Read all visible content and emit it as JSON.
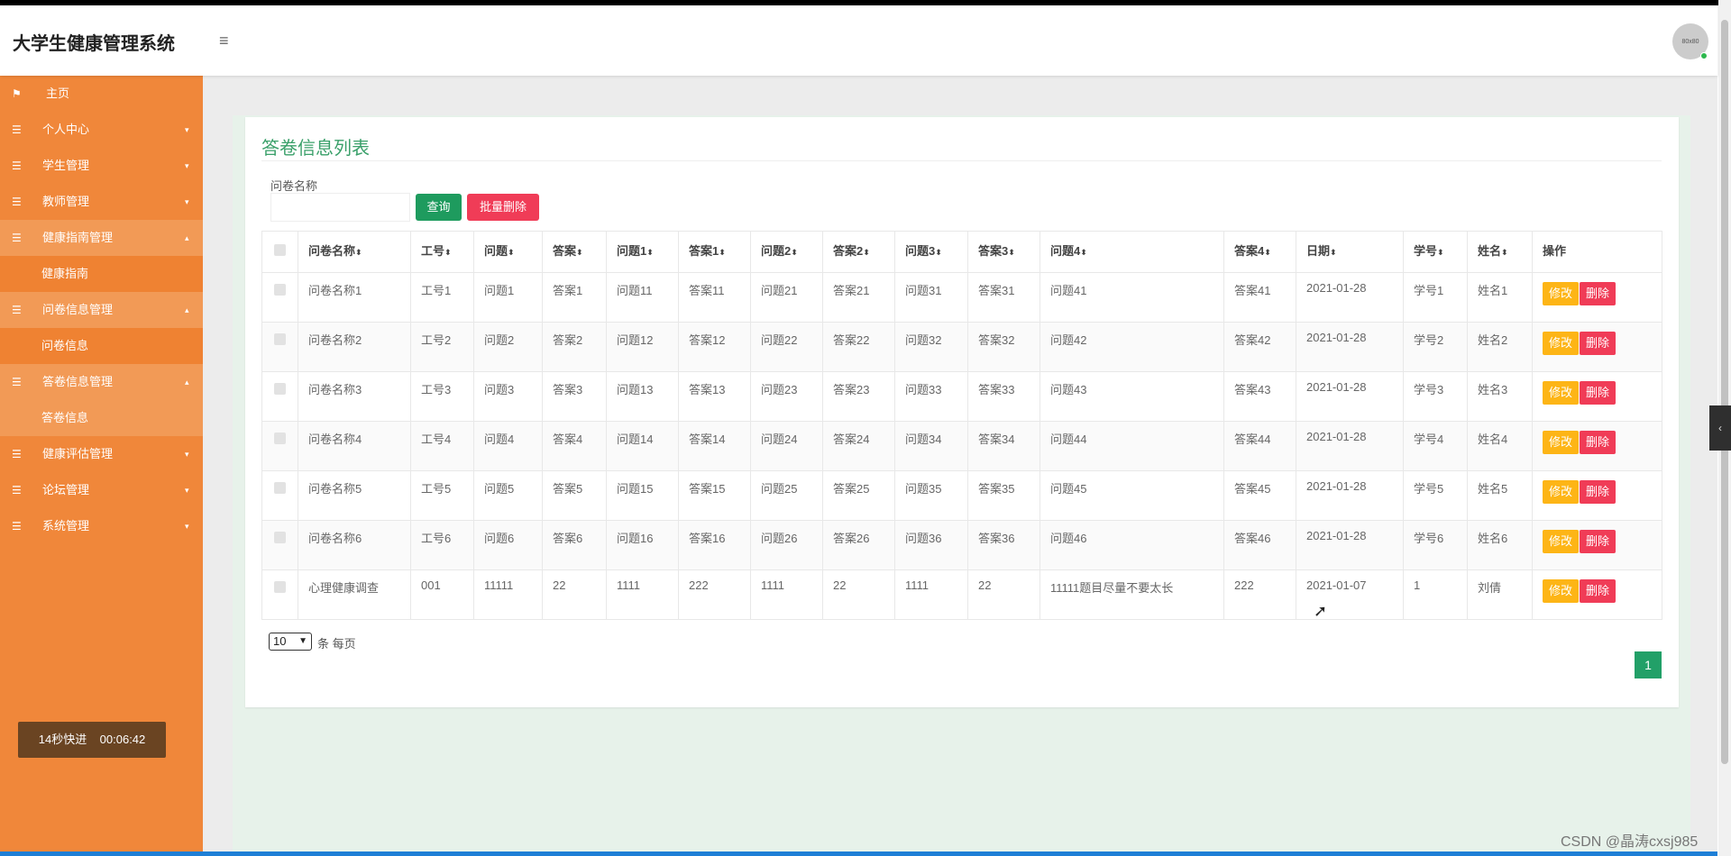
{
  "app": {
    "title": "大学生健康管理系统",
    "avatar_text": "80x80"
  },
  "sidebar": {
    "items": [
      {
        "label": "主页",
        "icon": "flag-icon"
      },
      {
        "label": "个人中心",
        "icon": "list-icon"
      },
      {
        "label": "学生管理",
        "icon": "list-icon"
      },
      {
        "label": "教师管理",
        "icon": "list-icon"
      },
      {
        "label": "健康指南管理",
        "icon": "list-icon"
      },
      {
        "label": "健康指南"
      },
      {
        "label": "问卷信息管理",
        "icon": "list-icon"
      },
      {
        "label": "问卷信息"
      },
      {
        "label": "答卷信息管理",
        "icon": "list-icon"
      },
      {
        "label": "答卷信息"
      },
      {
        "label": "健康评估管理",
        "icon": "list-icon"
      },
      {
        "label": "论坛管理",
        "icon": "list-icon"
      },
      {
        "label": "系统管理",
        "icon": "list-icon"
      }
    ],
    "timer_label": "14秒快进",
    "timer_value": "00:06:42"
  },
  "main": {
    "card_title": "答卷信息列表",
    "search_label": "问卷名称",
    "search_value": "",
    "query_button": "查询",
    "batch_delete_button": "批量删除",
    "table": {
      "headers": [
        "问卷名称",
        "工号",
        "问题",
        "答案",
        "问题1",
        "答案1",
        "问题2",
        "答案2",
        "问题3",
        "答案3",
        "问题4",
        "答案4",
        "日期",
        "学号",
        "姓名",
        "操作"
      ],
      "rows": [
        [
          "问卷名称1",
          "工号1",
          "问题1",
          "答案1",
          "问题11",
          "答案11",
          "问题21",
          "答案21",
          "问题31",
          "答案31",
          "问题41",
          "答案41",
          "2021-01-28",
          "学号1",
          "姓名1"
        ],
        [
          "问卷名称2",
          "工号2",
          "问题2",
          "答案2",
          "问题12",
          "答案12",
          "问题22",
          "答案22",
          "问题32",
          "答案32",
          "问题42",
          "答案42",
          "2021-01-28",
          "学号2",
          "姓名2"
        ],
        [
          "问卷名称3",
          "工号3",
          "问题3",
          "答案3",
          "问题13",
          "答案13",
          "问题23",
          "答案23",
          "问题33",
          "答案33",
          "问题43",
          "答案43",
          "2021-01-28",
          "学号3",
          "姓名3"
        ],
        [
          "问卷名称4",
          "工号4",
          "问题4",
          "答案4",
          "问题14",
          "答案14",
          "问题24",
          "答案24",
          "问题34",
          "答案34",
          "问题44",
          "答案44",
          "2021-01-28",
          "学号4",
          "姓名4"
        ],
        [
          "问卷名称5",
          "工号5",
          "问题5",
          "答案5",
          "问题15",
          "答案15",
          "问题25",
          "答案25",
          "问题35",
          "答案35",
          "问题45",
          "答案45",
          "2021-01-28",
          "学号5",
          "姓名5"
        ],
        [
          "问卷名称6",
          "工号6",
          "问题6",
          "答案6",
          "问题16",
          "答案16",
          "问题26",
          "答案26",
          "问题36",
          "答案36",
          "问题46",
          "答案46",
          "2021-01-28",
          "学号6",
          "姓名6"
        ],
        [
          "心理健康调查",
          "001",
          "11111",
          "22",
          "1111",
          "222",
          "1111",
          "22",
          "1111",
          "22",
          "11111题目尽量不要太长",
          "222",
          "2021-01-07",
          "1",
          "刘倩"
        ]
      ],
      "edit_label": "修改",
      "delete_label": "删除"
    },
    "pager": {
      "page_size": "10",
      "per_page_text": "条 每页",
      "current_page": "1"
    }
  },
  "watermark": "CSDN @晶涛cxsj985",
  "colors": {
    "sidebar": "#f0873a",
    "accent": "#3aa06a",
    "danger": "#f03c57",
    "warning": "#fdb516"
  }
}
